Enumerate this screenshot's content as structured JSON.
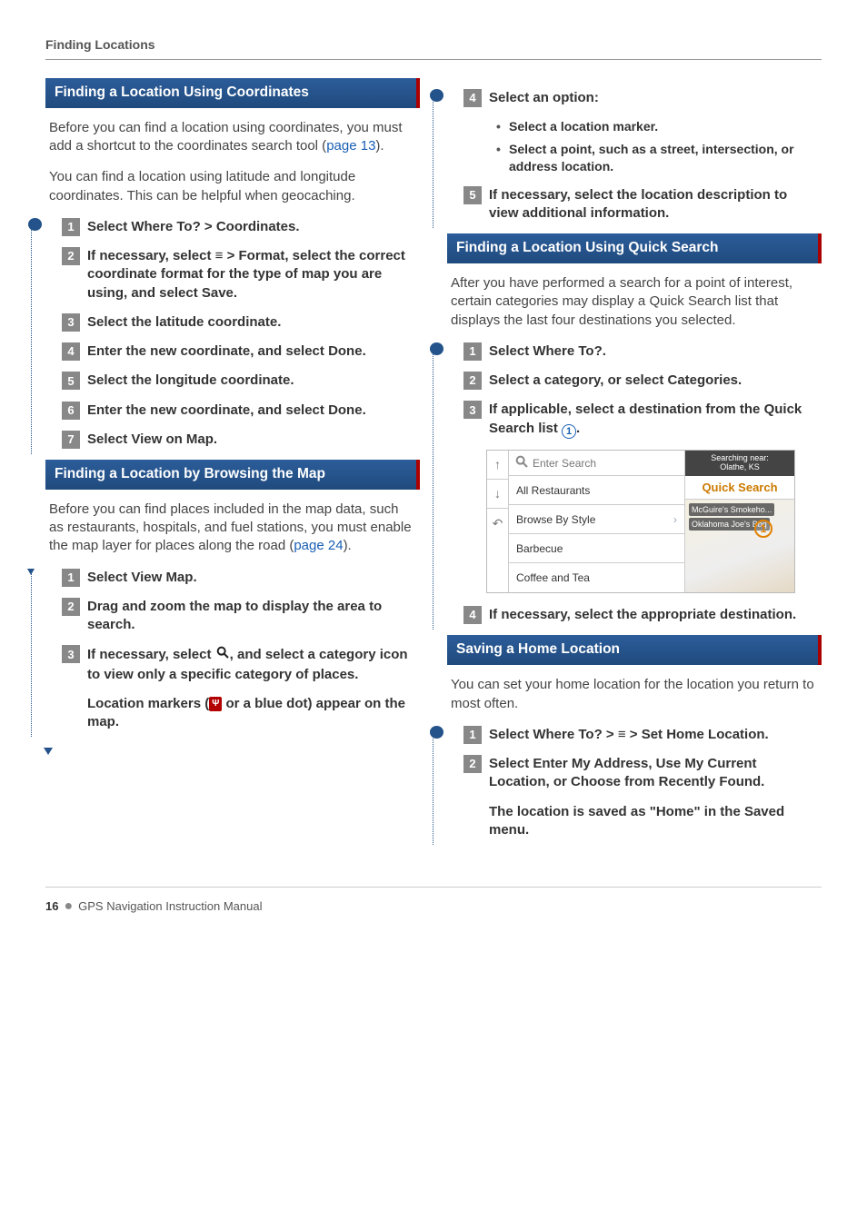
{
  "running_head": "Finding Locations",
  "footer": {
    "page": "16",
    "title": "GPS Navigation Instruction Manual"
  },
  "left": {
    "sec1": {
      "title": "Finding a Location Using Coordinates",
      "intro1a": "Before you can find a location using coordinates, you must add a shortcut to the coordinates search tool (",
      "intro1_link": "page 13",
      "intro1b": ").",
      "intro2": "You can find a location using latitude and longitude coordinates. This can be helpful when geocaching.",
      "steps": [
        "Select Where To? > Coordinates.",
        "If necessary, select ≡ > Format, select the correct coordinate format for the type of map you are using, and select Save.",
        "Select the latitude coordinate.",
        "Enter the new coordinate, and select Done.",
        "Select the longitude coordinate.",
        "Enter the new coordinate, and select Done.",
        "Select View on Map."
      ]
    },
    "sec2": {
      "title": "Finding a Location by Browsing the Map",
      "intro_a": "Before you can find places included in the map data, such as restaurants, hospitals, and fuel stations, you must enable the map layer for places along the road (",
      "intro_link": "page 24",
      "intro_b": ").",
      "step1": "Select View Map.",
      "step2": "Drag and zoom the map to display the area to search.",
      "step3a": "If necessary, select ",
      "step3b": ", and select a category icon to view only a specific category of places.",
      "result_a": "Location markers (",
      "result_b": " or a blue dot) appear on the map."
    }
  },
  "right": {
    "sec2cont": {
      "step4": "Select an option:",
      "bullets": [
        "Select a location marker.",
        "Select a point, such as a street, intersection, or address location."
      ],
      "step5": "If necessary, select the location description to view additional information."
    },
    "sec3": {
      "title": "Finding a Location Using Quick Search",
      "intro": "After you have performed a search for a point of interest, certain categories may display a Quick Search list that displays the last four destinations you selected.",
      "step1": "Select Where To?.",
      "step2": "Select a category, or select Categories.",
      "step3a": "If applicable, select a destination from the Quick Search list ",
      "step3b": ".",
      "step4": "If necessary, select the appropriate destination."
    },
    "screenshot": {
      "search_placeholder": "Enter Search",
      "near_label": "Searching near:",
      "near_value": "Olathe, KS",
      "items": [
        "All Restaurants",
        "Browse By Style",
        "Barbecue",
        "Coffee and Tea"
      ],
      "qs_title": "Quick Search",
      "qs_items": [
        "McGuire's Smokeho...",
        "Oklahoma Joe's Bbq"
      ],
      "callout": "1"
    },
    "sec4": {
      "title": "Saving a Home Location",
      "intro": "You can set your home location for the location you return to most often.",
      "step1": "Select Where To? > ≡ > Set Home Location.",
      "step2": "Select Enter My Address, Use My Current Location, or Choose from Recently Found.",
      "result": "The location is saved as \"Home\" in the Saved menu."
    }
  },
  "icons": {
    "pin_label": "♣"
  }
}
